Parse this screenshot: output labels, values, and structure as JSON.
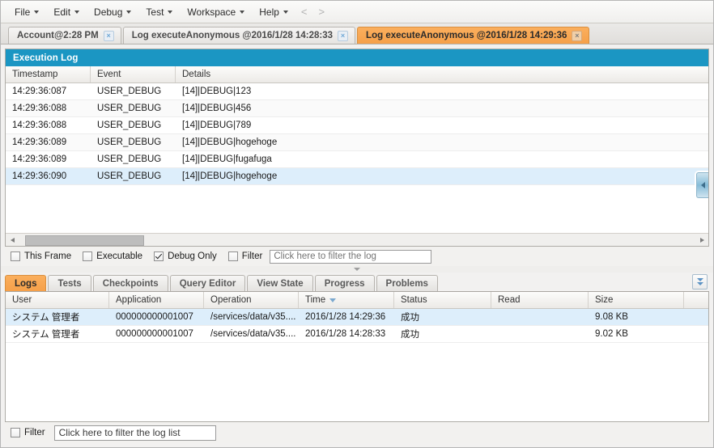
{
  "menubar": {
    "items": [
      {
        "label": "File",
        "has_caret": true
      },
      {
        "label": "Edit",
        "has_caret": true
      },
      {
        "label": "Debug",
        "has_caret": true
      },
      {
        "label": "Test",
        "has_caret": true
      },
      {
        "label": "Workspace",
        "has_caret": true
      },
      {
        "label": "Help",
        "has_caret": true
      }
    ],
    "nav_prev": "<",
    "nav_next": ">"
  },
  "doc_tabs": [
    {
      "label": "Account@2:28 PM",
      "active": false,
      "close": "×"
    },
    {
      "label": "Log executeAnonymous @2016/1/28 14:28:33",
      "active": false,
      "close": "×"
    },
    {
      "label": "Log executeAnonymous @2016/1/28 14:29:36",
      "active": true,
      "close": "×"
    }
  ],
  "execution_log": {
    "title": "Execution Log",
    "columns": [
      "Timestamp",
      "Event",
      "Details"
    ],
    "rows": [
      {
        "timestamp": "14:29:36:087",
        "event": "USER_DEBUG",
        "details": "[14]|DEBUG|123",
        "selected": false
      },
      {
        "timestamp": "14:29:36:088",
        "event": "USER_DEBUG",
        "details": "[14]|DEBUG|456",
        "selected": false
      },
      {
        "timestamp": "14:29:36:088",
        "event": "USER_DEBUG",
        "details": "[14]|DEBUG|789",
        "selected": false
      },
      {
        "timestamp": "14:29:36:089",
        "event": "USER_DEBUG",
        "details": "[14]|DEBUG|hogehoge",
        "selected": false
      },
      {
        "timestamp": "14:29:36:089",
        "event": "USER_DEBUG",
        "details": "[14]|DEBUG|fugafuga",
        "selected": false
      },
      {
        "timestamp": "14:29:36:090",
        "event": "USER_DEBUG",
        "details": "[14]|DEBUG|hogehoge",
        "selected": true
      }
    ]
  },
  "log_filterbar": {
    "this_frame": {
      "label": "This Frame",
      "checked": false
    },
    "executable": {
      "label": "Executable",
      "checked": false
    },
    "debug_only": {
      "label": "Debug Only",
      "checked": true
    },
    "filter": {
      "label": "Filter",
      "checked": false
    },
    "input_placeholder": "Click here to filter the log",
    "input_value": ""
  },
  "bottom_tabs": [
    {
      "label": "Logs",
      "active": true
    },
    {
      "label": "Tests",
      "active": false
    },
    {
      "label": "Checkpoints",
      "active": false
    },
    {
      "label": "Query Editor",
      "active": false
    },
    {
      "label": "View State",
      "active": false
    },
    {
      "label": "Progress",
      "active": false
    },
    {
      "label": "Problems",
      "active": false
    }
  ],
  "log_grid": {
    "columns": [
      {
        "label": "User",
        "sorted": false
      },
      {
        "label": "Application",
        "sorted": false
      },
      {
        "label": "Operation",
        "sorted": false
      },
      {
        "label": "Time",
        "sorted": true
      },
      {
        "label": "Status",
        "sorted": false
      },
      {
        "label": "Read",
        "sorted": false
      },
      {
        "label": "Size",
        "sorted": false
      }
    ],
    "rows": [
      {
        "user": "システム 管理者",
        "application": "000000000001007",
        "operation": "/services/data/v35....",
        "time": "2016/1/28 14:29:36",
        "status": "成功",
        "read": "",
        "size": "9.08 KB",
        "selected": true
      },
      {
        "user": "システム 管理者",
        "application": "000000000001007",
        "operation": "/services/data/v35....",
        "time": "2016/1/28 14:28:33",
        "status": "成功",
        "read": "",
        "size": "9.02 KB",
        "selected": false
      }
    ]
  },
  "bottom_filterbar": {
    "filter": {
      "label": "Filter",
      "checked": false
    },
    "input_placeholder": "Click here to filter the log list",
    "input_value": "Click here to filter the log list"
  },
  "colors": {
    "accent_orange": "#f5a04a",
    "header_blue": "#1b96c3",
    "selection_blue": "#ddeefb",
    "chrome_gray": "#f2f1f0"
  }
}
